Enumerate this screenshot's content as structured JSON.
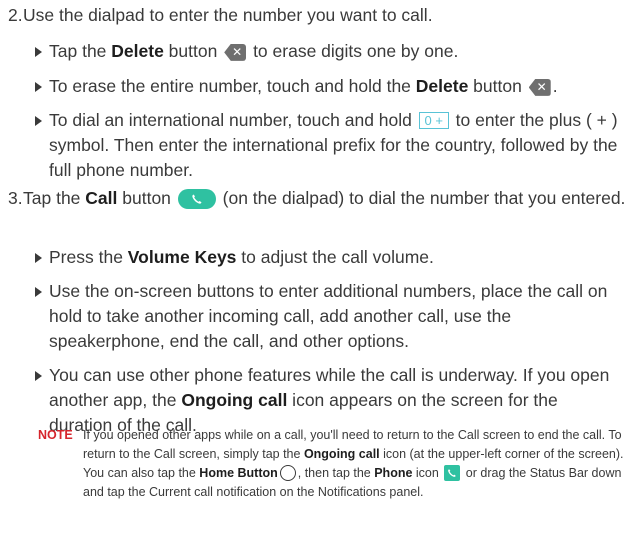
{
  "step2": {
    "number": "2.",
    "text": "Use the dialpad to enter the number you want to call.",
    "bullets": {
      "b1": {
        "pre": "Tap the ",
        "bold": "Delete",
        "post": " button ",
        "end": " to erase digits one by one."
      },
      "b2": {
        "pre": "To erase the entire number, touch and hold the ",
        "bold": "Delete",
        "post": " button ",
        "end": "."
      },
      "b3": {
        "pre": "To dial an international number, touch and hold ",
        "icon_text": "0 +",
        "post": " to enter the plus ( + ) symbol. Then enter the international prefix for the country, followed by the full phone number."
      }
    }
  },
  "step3": {
    "number": "3.",
    "pre": "Tap the ",
    "bold": "Call",
    "post": " button ",
    "end": " (on the dialpad) to dial the number that you entered.",
    "bullets": {
      "b1": {
        "pre": "Press the ",
        "bold": "Volume Keys",
        "post": " to adjust the call volume."
      },
      "b2": {
        "text": "Use the on-screen buttons to enter additional numbers, place the call on hold to take another incoming call, add another call, use the speakerphone, end the call, and other options."
      },
      "b3": {
        "pre": "You can use other phone features while the call is underway. If you open another app, the ",
        "bold": "Ongoing call",
        "post": " icon appears on the screen for the duration of the call."
      }
    }
  },
  "note": {
    "label": "NOTE",
    "t1": "If you opened other apps while on a call, you'll need to return to the Call screen to end the call. To return to the Call screen, simply tap the ",
    "b1": "Ongoing call",
    "t2": " icon (at the upper-left corner of the screen). You can also tap the ",
    "b2": "Home Button",
    "t3": ", then tap the ",
    "b3": "Phone",
    "t4": " icon ",
    "t5": " or drag the Status Bar down and tap the Current call notification on the Notifications panel."
  },
  "icons": {
    "delete": "delete-backspace-icon",
    "dialpad_zero": "zero-plus-key-icon",
    "call": "call-button-icon",
    "home": "home-circle-icon",
    "phone": "phone-app-icon"
  },
  "colors": {
    "accent_teal": "#2fc1a1",
    "key_cyan": "#59c3d6",
    "note_red": "#d6252c",
    "text": "#3a3a3a"
  }
}
